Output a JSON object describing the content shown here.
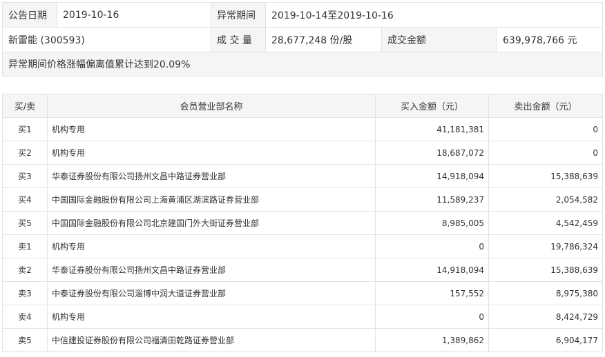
{
  "summary": {
    "announce_date_label": "公告日期",
    "announce_date": "2019-10-16",
    "abnormal_period_label": "异常期间",
    "abnormal_period": "2019-10-14至2019-10-16",
    "stock": "新雷能 (300593)",
    "volume_label": "成 交 量",
    "volume": "28,677,248 份/股",
    "turnover_label": "成交金额",
    "turnover": "639,978,766 元",
    "note": "异常期间价格涨幅偏离值累计达到20.09%"
  },
  "detail": {
    "headers": {
      "side": "买/卖",
      "dept": "会员营业部名称",
      "buy": "买入金额（元）",
      "sell": "卖出金额（元）"
    },
    "rows": [
      {
        "side": "买1",
        "dept": "机构专用",
        "buy": "41,181,381",
        "sell": "0"
      },
      {
        "side": "买2",
        "dept": "机构专用",
        "buy": "18,687,072",
        "sell": "0"
      },
      {
        "side": "买3",
        "dept": "华泰证券股份有限公司扬州文昌中路证券营业部",
        "buy": "14,918,094",
        "sell": "15,388,639"
      },
      {
        "side": "买4",
        "dept": "中国国际金融股份有限公司上海黄浦区湖滨路证券营业部",
        "buy": "11,589,237",
        "sell": "2,054,582"
      },
      {
        "side": "买5",
        "dept": "中国国际金融股份有限公司北京建国门外大街证券营业部",
        "buy": "8,985,005",
        "sell": "4,542,459"
      },
      {
        "side": "卖1",
        "dept": "机构专用",
        "buy": "0",
        "sell": "19,786,324"
      },
      {
        "side": "卖2",
        "dept": "华泰证券股份有限公司扬州文昌中路证券营业部",
        "buy": "14,918,094",
        "sell": "15,388,639"
      },
      {
        "side": "卖3",
        "dept": "中泰证券股份有限公司淄博中润大道证券营业部",
        "buy": "157,552",
        "sell": "8,975,380"
      },
      {
        "side": "卖4",
        "dept": "机构专用",
        "buy": "0",
        "sell": "8,424,729"
      },
      {
        "side": "卖5",
        "dept": "中信建投证券股份有限公司福清田乾路证券营业部",
        "buy": "1,389,862",
        "sell": "6,904,177"
      }
    ]
  }
}
